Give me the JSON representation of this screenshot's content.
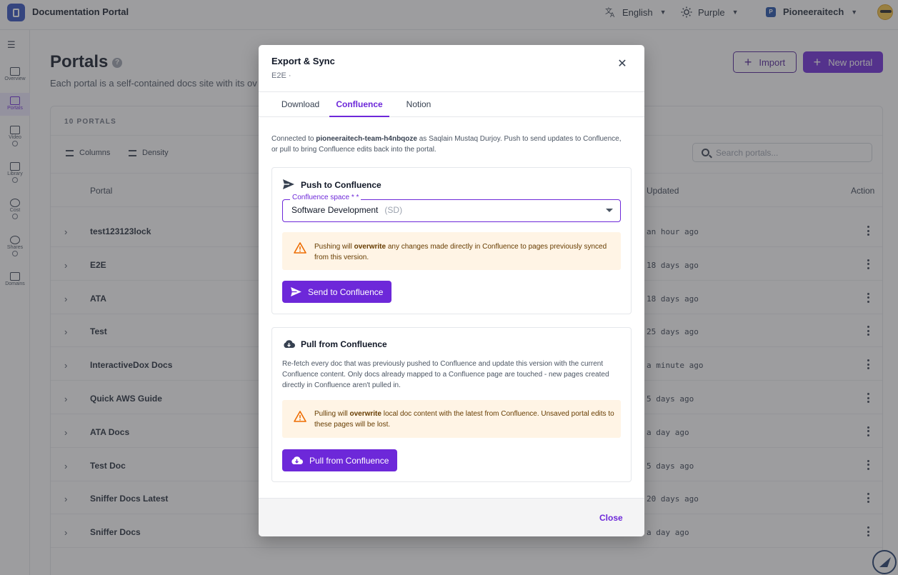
{
  "app": {
    "title": "Documentation Portal"
  },
  "topbar": {
    "language": "English",
    "theme": "Purple",
    "org": "Pioneeraitech",
    "org_initial": "P"
  },
  "sidebar": {
    "items": [
      {
        "label": "Overview",
        "icon": "grid-icon"
      },
      {
        "label": "Portals",
        "icon": "portals-icon"
      },
      {
        "label": "Video",
        "icon": "video-icon"
      },
      {
        "label": "Library",
        "icon": "library-icon"
      },
      {
        "label": "Cost",
        "icon": "dollar-icon"
      },
      {
        "label": "Shares",
        "icon": "share-icon"
      },
      {
        "label": "Domains",
        "icon": "domains-icon"
      }
    ]
  },
  "page": {
    "title": "Portals",
    "subtitle": "Each portal is a self-contained docs site with its ov",
    "import_label": "Import",
    "new_label": "New portal"
  },
  "table": {
    "count_label": "10 PORTALS",
    "columns_label": "Columns",
    "density_label": "Density",
    "search_placeholder": "Search portals...",
    "headers": {
      "portal": "Portal",
      "updated": "Updated",
      "action": "Action"
    },
    "rows": [
      {
        "name": "test123123lock",
        "updated": "an hour ago"
      },
      {
        "name": "E2E",
        "updated": "18 days ago"
      },
      {
        "name": "ATA",
        "updated": "18 days ago"
      },
      {
        "name": "Test",
        "updated": "25 days ago"
      },
      {
        "name": "InteractiveDox Docs",
        "updated": "a minute ago"
      },
      {
        "name": "Quick AWS Guide",
        "updated": "5 days ago"
      },
      {
        "name": "ATA Docs",
        "updated": "a day ago"
      },
      {
        "name": "Test Doc",
        "updated": "5 days ago"
      },
      {
        "name": "Sniffer Docs Latest",
        "updated": "20 days ago"
      },
      {
        "name": "Sniffer Docs",
        "updated": "a day ago"
      }
    ]
  },
  "modal": {
    "title": "Export & Sync",
    "subtitle": "E2E ·",
    "tabs": [
      "Download",
      "Confluence",
      "Notion"
    ],
    "intro_pre": "Connected to ",
    "intro_space": "pioneeraitech-team-h4nbqoze",
    "intro_post": " as Saqlain Mustaq Durjoy. Push to send updates to Confluence, or pull to bring Confluence edits back into the portal.",
    "push": {
      "title": "Push to Confluence",
      "field_label": "Confluence space * *",
      "field_value": "Software Development",
      "field_code": "(SD)",
      "warn_pre": "Pushing will ",
      "warn_bold": "overwrite",
      "warn_post": " any changes made directly in Confluence to pages previously synced from this version.",
      "button": "Send to Confluence"
    },
    "pull": {
      "title": "Pull from Confluence",
      "description": "Re-fetch every doc that was previously pushed to Confluence and update this version with the current Confluence content. Only docs already mapped to a Confluence page are touched - new pages created directly in Confluence aren't pulled in.",
      "warn_pre": "Pulling will ",
      "warn_bold": "overwrite",
      "warn_post": " local doc content with the latest from Confluence. Unsaved portal edits to these pages will be lost.",
      "button": "Pull from Confluence"
    },
    "close_label": "Close"
  },
  "colors": {
    "accent": "#6d28d9",
    "warning_bg": "#fff4e5",
    "warning_icon": "#ed6c02"
  }
}
